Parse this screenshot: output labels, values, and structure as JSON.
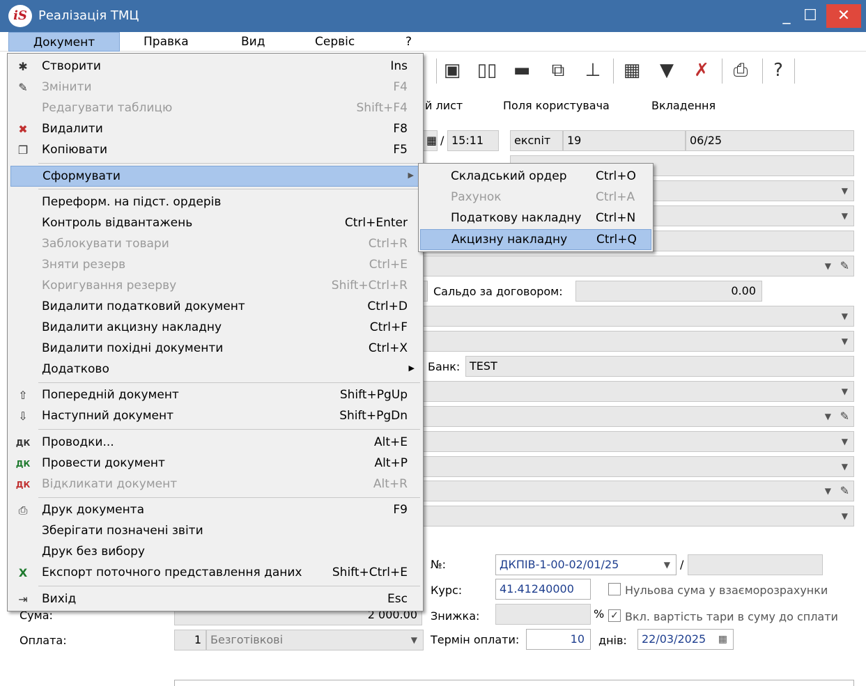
{
  "window": {
    "title": "Реалізація ТМЦ",
    "logo_text": "iS"
  },
  "menubar": {
    "items": [
      {
        "label": "Документ"
      },
      {
        "label": "Правка"
      },
      {
        "label": "Вид"
      },
      {
        "label": "Сервіс"
      },
      {
        "label": "?"
      }
    ]
  },
  "tabs": [
    {
      "label": "й лист"
    },
    {
      "label": "Поля користувача"
    },
    {
      "label": "Вкладення"
    }
  ],
  "form": {
    "time": "15:11",
    "code": "ексniт",
    "num": "19",
    "period": "06/25",
    "saldo_label": "Сальдо за договором:",
    "saldo_value": "0.00",
    "bank_label": "Банк:",
    "bank_value": "TEST",
    "no_label": "№:",
    "no_value": "ДКПІВ-1-00-02/01/25",
    "kurs_label": "Курс:",
    "kurs_value": "41.41240000",
    "zero_sum_label": "Нульова сума у взаєморозрахунки",
    "suma_label": "Сума:",
    "suma_value": "2 000.00",
    "znyzhka_label": "Знижка:",
    "percent": "%",
    "tara_label": "Вкл. вартість тари в суму до сплати",
    "oplata_label": "Оплата:",
    "oplata_num": "1",
    "oplata_value": "Безготівкові",
    "termin_label": "Термін оплати:",
    "termin_value": "10",
    "dniv_label": "днів:",
    "date_value": "22/03/2025"
  },
  "dropmenu": {
    "items": [
      {
        "label": "Створити",
        "shortcut": "Ins",
        "icon": "new-doc-icon",
        "glyph": "✱"
      },
      {
        "label": "Змінити",
        "shortcut": "F4",
        "icon": "edit-doc-icon",
        "glyph": "✎"
      },
      {
        "label": "Редагувати таблицю",
        "shortcut": "Shift+F4"
      },
      {
        "label": "Видалити",
        "shortcut": "F8",
        "icon": "delete-doc-icon",
        "glyph": "✖"
      },
      {
        "label": "Копіювати",
        "shortcut": "F5",
        "icon": "copy-icon",
        "glyph": "❐"
      },
      {
        "label": "Сформувати",
        "shortcut": ""
      },
      {
        "label": "Переформ. на підст. ордерів",
        "shortcut": ""
      },
      {
        "label": "Контроль відвантажень",
        "shortcut": "Ctrl+Enter"
      },
      {
        "label": "Заблокувати товари",
        "shortcut": "Ctrl+R"
      },
      {
        "label": "Зняти резерв",
        "shortcut": "Ctrl+E"
      },
      {
        "label": "Коригування резерву",
        "shortcut": "Shift+Ctrl+R"
      },
      {
        "label": "Видалити податковий документ",
        "shortcut": "Ctrl+D"
      },
      {
        "label": "Видалити акцизну накладну",
        "shortcut": "Ctrl+F"
      },
      {
        "label": "Видалити похідні документи",
        "shortcut": "Ctrl+X"
      },
      {
        "label": "Додатково",
        "shortcut": ""
      },
      {
        "label": "Попередній документ",
        "shortcut": "Shift+PgUp",
        "icon": "prev-doc-icon",
        "glyph": "⇧"
      },
      {
        "label": "Наступний документ",
        "shortcut": "Shift+PgDn",
        "icon": "next-doc-icon",
        "glyph": "⇩"
      },
      {
        "label": "Проводки...",
        "shortcut": "Alt+E",
        "icon": "dk-icon",
        "glyph": "ДК"
      },
      {
        "label": "Провести документ",
        "shortcut": "Alt+P",
        "icon": "dk-post-icon",
        "glyph": "ДК"
      },
      {
        "label": "Відкликати документ",
        "shortcut": "Alt+R",
        "icon": "dk-revoke-icon",
        "glyph": "ДК"
      },
      {
        "label": "Друк документа",
        "shortcut": "F9",
        "icon": "print-icon",
        "glyph": "⎙"
      },
      {
        "label": "Зберігати позначені звіти",
        "shortcut": ""
      },
      {
        "label": "Друк без вибору",
        "shortcut": ""
      },
      {
        "label": "Експорт поточного представлення даних",
        "shortcut": "Shift+Ctrl+E",
        "icon": "excel-icon",
        "glyph": "X"
      },
      {
        "label": "Вихід",
        "shortcut": "Esc",
        "icon": "exit-icon",
        "glyph": "⇥"
      }
    ]
  },
  "submenu": {
    "items": [
      {
        "label": "Складський ордер",
        "shortcut": "Ctrl+O"
      },
      {
        "label": "Рахунок",
        "shortcut": "Ctrl+A"
      },
      {
        "label": "Податкову накладну",
        "shortcut": "Ctrl+N"
      },
      {
        "label": "Акцизну накладну",
        "shortcut": "Ctrl+Q"
      }
    ]
  }
}
